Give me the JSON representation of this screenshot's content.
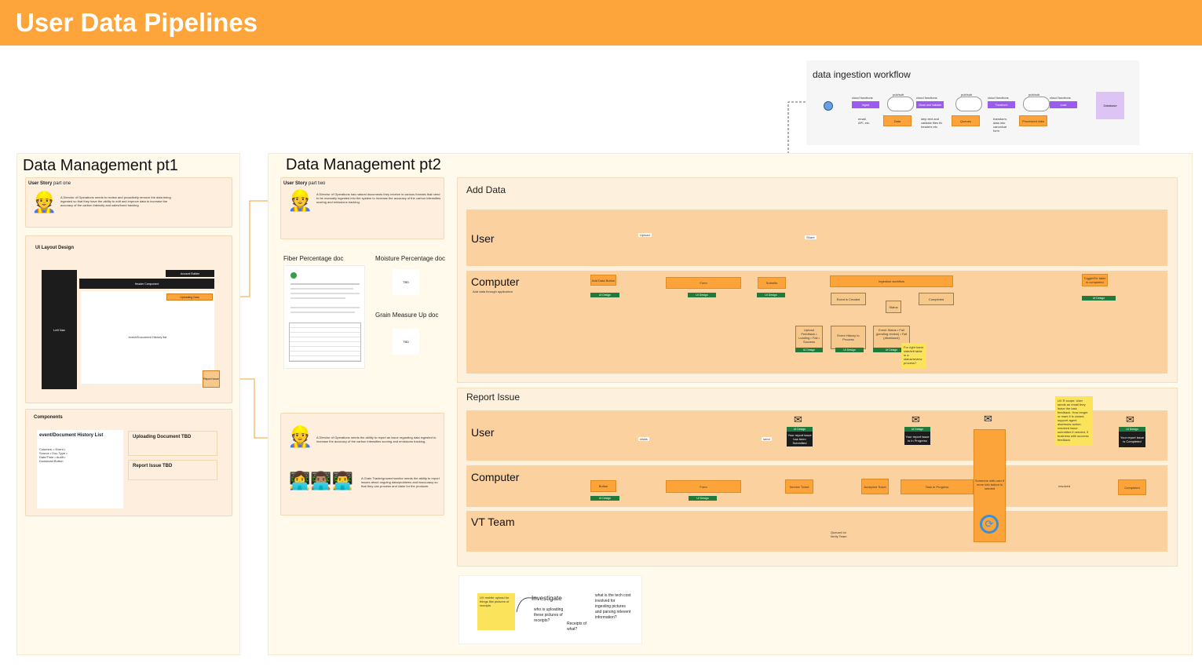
{
  "header": {
    "title": "User Data Pipelines"
  },
  "colors": {
    "accent": "#fda53a",
    "lane": "#fbd29f",
    "tag_green": "#1f7a3b",
    "purple": "#9b5bf0",
    "sticky": "#fbe45c"
  },
  "pt1": {
    "title": "Data Management pt1",
    "user_story": {
      "label": "User Story",
      "suffix": "part one",
      "body": "A Director of Operations needs to review and proactively remove the data being ingested so that they have the ability to edit and improve data to increase the accuracy of the carbon intensity and sales/bond tracking"
    },
    "layout": {
      "title": "UI Layout Design",
      "account_btn": "Account Builder",
      "header_component": "Header Component",
      "uploading_data": "Uploading Data",
      "left_nav": "Left Nav",
      "event_history": "event/Document History list",
      "report_issue": "Report Issue"
    },
    "components": {
      "title": "Components",
      "list_title": "event/Document History List",
      "list_body": "Columns: • Event • Source • Doc Type • Date/Time • Audit • Download Button",
      "uploading": "Uploading Document TBD",
      "report": "Report Issue TBD"
    }
  },
  "pt2": {
    "title": "Data Management pt2",
    "user_story2": {
      "label": "User Story",
      "suffix": "part two",
      "body": "A Director of Operations has natural documents they receive in various formats that need to be manually ingested into the system to increase the accuracy of the carbon intensities scoring and emissions tracking."
    },
    "fiber_title": "Fiber Percentage doc",
    "moisture_title": "Moisture Percentage doc",
    "moisture_body": "TBD",
    "grain_title": "Grain Measure Up doc",
    "grain_body": "TBD",
    "story3_body": "A Director of Operations needs the ability to report an issue regarding data ingested to increase the accuracy of the carbon intensities scoring and emissions tracking.",
    "story4_body": "A Grain Trader/grower/monitor needs the ability to report issues about ongoing data/problems and inaccuracy so that they can process and claim for the producer."
  },
  "workflow": {
    "title": "data ingestion workflow",
    "stages": [
      {
        "label": "cloud functions",
        "box": "Ingest",
        "note": "email, API, etc.",
        "store": "Data"
      },
      {
        "label": "cloud functions",
        "box": "Clean and Validate",
        "note": "strip text and validate files fix headers etc.",
        "store": "Queues"
      },
      {
        "label": "cloud functions",
        "box": "Transform",
        "note": "transform, data into canonical form",
        "store": "Processed data"
      },
      {
        "label": "cloud functions",
        "box": "Load",
        "note": "",
        "store": ""
      }
    ],
    "pub_label": "pub/sub",
    "end": "Database"
  },
  "add_data": {
    "title": "Add Data",
    "lane_user": "User",
    "lane_computer": "Computer",
    "lane_computer_sub": "Add data through application",
    "upload_label": "Upload",
    "share_label": "Share",
    "boxes": {
      "add_data_button": "Add Data Button",
      "form": "Form",
      "submits": "Submits",
      "ingestion": "Ingestion workflow",
      "event_created": "Event is Created",
      "status": "Status",
      "completed": "Completed",
      "toggle": "Toggle/Err table is completed",
      "upload_feedback": "Upload Feedback • Loading • Fail • Success",
      "event_history": "Event History to Process",
      "event_status": "Event Status • Fail (pending review) • Fail (dismissed)"
    },
    "ui_design": "UI Design",
    "sticky": "For right hand side/left table in a status/review process?"
  },
  "report": {
    "title": "Report Issue",
    "lane_user": "User",
    "lane_computer": "Computer",
    "lane_vt": "VT Team",
    "boxes": {
      "button": "Button",
      "form": "Form",
      "service_ticket": "Service Ticket",
      "accepted": "Accepted Ticket",
      "in_progress": "Task In Progress",
      "someone": "Someone with user if more info button is needed",
      "completed": "Completed",
      "queued": "Queued for Verity Team"
    },
    "notify1": "Your report issue has been Submitted",
    "notify2": "Your report issue is In Progress",
    "notify3": "Your report issue is Completed",
    "edge_labels": {
      "click": "clicks",
      "send": "send",
      "resolved": "resolved"
    },
    "sticky": "UX R scope: User sends an email they leave the task feedback. How longer or mark it is closed, support agent dismisses action; resolved issue submitted if needed, if business with success feedback"
  },
  "notes": {
    "sticky": "UX mobile upload for things like pictures of receipts",
    "investigate": "Investigate",
    "who": "who is uploading these pictures of receipts?",
    "receipts": "Receipts of what?",
    "tech": "what is the tech cost involved for ingesting pictures and parsing relevent information?"
  }
}
